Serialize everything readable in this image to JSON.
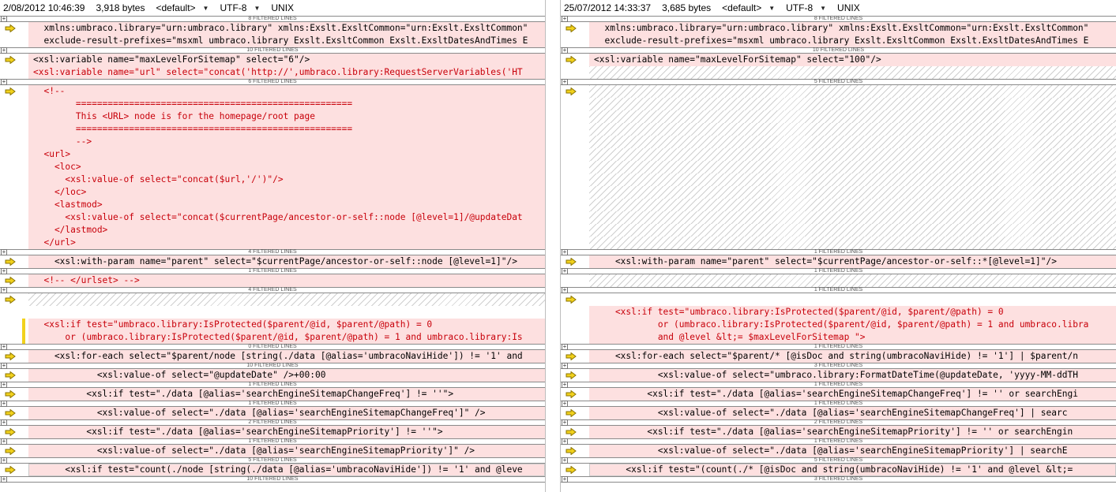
{
  "left_pane": {
    "header": {
      "timestamp": "2/08/2012 10:46:39",
      "size": "3,918 bytes",
      "profile": "<default>",
      "encoding": "UTF-8",
      "line_ending": "UNIX"
    },
    "blocks": [
      {
        "sep": "8 FILTERED LINES",
        "rows": [
          {
            "text": "  xmlns:umbraco.library=\"urn:umbraco.library\" xmlns:Exslt.ExsltCommon=\"urn:Exslt.ExsltCommon\"",
            "arrow": true,
            "style": "plain"
          },
          {
            "text": "  exclude-result-prefixes=\"msxml umbraco.library Exslt.ExsltCommon Exslt.ExsltDatesAndTimes E",
            "arrow": false,
            "style": "plain"
          }
        ]
      },
      {
        "sep": "10 FILTERED LINES",
        "rows": [
          {
            "text": "<xsl:variable name=\"maxLevelForSitemap\" select=\"6\"/>",
            "arrow": true,
            "style": "plain"
          },
          {
            "text": "<xsl:variable name=\"url\" select=\"concat('http://',umbraco.library:RequestServerVariables('HT",
            "arrow": false,
            "style": "del"
          }
        ]
      },
      {
        "sep": "6 FILTERED LINES",
        "rows": [
          {
            "text": "  <!--",
            "arrow": true,
            "style": "del"
          },
          {
            "text": "        ====================================================",
            "arrow": false,
            "style": "del"
          },
          {
            "text": "        This <URL> node is for the homepage/root page",
            "arrow": false,
            "style": "del"
          },
          {
            "text": "        ====================================================",
            "arrow": false,
            "style": "del"
          },
          {
            "text": "        -->",
            "arrow": false,
            "style": "del"
          },
          {
            "text": "  <url>",
            "arrow": false,
            "style": "del"
          },
          {
            "text": "    <loc>",
            "arrow": false,
            "style": "del"
          },
          {
            "text": "      <xsl:value-of select=\"concat($url,'/')\"/>",
            "arrow": false,
            "style": "del"
          },
          {
            "text": "    </loc>",
            "arrow": false,
            "style": "del"
          },
          {
            "text": "    <lastmod>",
            "arrow": false,
            "style": "del"
          },
          {
            "text": "      <xsl:value-of select=\"concat($currentPage/ancestor-or-self::node [@level=1]/@updateDat",
            "arrow": false,
            "style": "del"
          },
          {
            "text": "    </lastmod>",
            "arrow": false,
            "style": "del"
          },
          {
            "text": "  </url>",
            "arrow": false,
            "style": "del"
          }
        ]
      },
      {
        "sep": "4 FILTERED LINES",
        "rows": [
          {
            "text": "    <xsl:with-param name=\"parent\" select=\"$currentPage/ancestor-or-self::node [@level=1]\"/>",
            "arrow": true,
            "style": "plain"
          }
        ]
      },
      {
        "sep": "1 FILTERED LINES",
        "rows": [
          {
            "text": "  <!-- </urlset> -->",
            "arrow": true,
            "style": "del"
          }
        ]
      },
      {
        "sep": "4 FILTERED LINES",
        "rows": [
          {
            "text": "",
            "arrow": true,
            "style": "hatch"
          },
          {
            "text": "",
            "arrow": false,
            "style": "white"
          },
          {
            "text": "  <xsl:if test=\"umbraco.library:IsProtected($parent/@id, $parent/@path) = 0",
            "arrow": false,
            "style": "del",
            "bar": true
          },
          {
            "text": "      or (umbraco.library:IsProtected($parent/@id, $parent/@path) = 1 and umbraco.library:Is",
            "arrow": false,
            "style": "del",
            "bar": true
          }
        ]
      },
      {
        "sep": "0 FILTERED LINES",
        "rows": [
          {
            "text": "    <xsl:for-each select=\"$parent/node [string(./data [@alias='umbracoNaviHide']) != '1' and",
            "arrow": true,
            "style": "plain"
          }
        ]
      },
      {
        "sep": "10 FILTERED LINES",
        "rows": [
          {
            "text": "            <xsl:value-of select=\"@updateDate\" />+00:00",
            "arrow": true,
            "style": "plain"
          }
        ]
      },
      {
        "sep": "1 FILTERED LINES",
        "rows": [
          {
            "text": "          <xsl:if test=\"./data [@alias='searchEngineSitemapChangeFreq'] != ''\">",
            "arrow": true,
            "style": "plain"
          }
        ]
      },
      {
        "sep": "1 FILTERED LINES",
        "rows": [
          {
            "text": "            <xsl:value-of select=\"./data [@alias='searchEngineSitemapChangeFreq']\" />",
            "arrow": true,
            "style": "plain"
          }
        ]
      },
      {
        "sep": "2 FILTERED LINES",
        "rows": [
          {
            "text": "          <xsl:if test=\"./data [@alias='searchEngineSitemapPriority'] != ''\">",
            "arrow": true,
            "style": "plain"
          }
        ]
      },
      {
        "sep": "1 FILTERED LINES",
        "rows": [
          {
            "text": "            <xsl:value-of select=\"./data [@alias='searchEngineSitemapPriority']\" />",
            "arrow": true,
            "style": "plain"
          }
        ]
      },
      {
        "sep": "5 FILTERED LINES",
        "rows": [
          {
            "text": "      <xsl:if test=\"count(./node [string(./data [@alias='umbracoNaviHide']) != '1' and @leve",
            "arrow": true,
            "style": "boxed"
          }
        ]
      },
      {
        "sep": "10 FILTERED LINES",
        "rows": []
      }
    ]
  },
  "right_pane": {
    "header": {
      "timestamp": "25/07/2012 14:33:37",
      "size": "3,685 bytes",
      "profile": "<default>",
      "encoding": "UTF-8",
      "line_ending": "UNIX"
    },
    "blocks": [
      {
        "sep": "8 FILTERED LINES",
        "rows": [
          {
            "text": "  xmlns:umbraco.library=\"urn:umbraco.library\" xmlns:Exslt.ExsltCommon=\"urn:Exslt.ExsltCommon\"",
            "arrow": true,
            "style": "plain"
          },
          {
            "text": "  exclude-result-prefixes=\"msxml umbraco.library Exslt.ExsltCommon Exslt.ExsltDatesAndTimes E",
            "arrow": false,
            "style": "plain"
          }
        ]
      },
      {
        "sep": "10 FILTERED LINES",
        "rows": [
          {
            "text": "<xsl:variable name=\"maxLevelForSitemap\" select=\"100\"/>",
            "arrow": true,
            "style": "plain"
          },
          {
            "text": "",
            "arrow": false,
            "style": "hatch"
          }
        ]
      },
      {
        "sep": "5 FILTERED LINES",
        "rows": [
          {
            "text": "",
            "arrow": true,
            "style": "hatch"
          },
          {
            "text": "",
            "arrow": false,
            "style": "hatch"
          },
          {
            "text": "",
            "arrow": false,
            "style": "hatch"
          },
          {
            "text": "",
            "arrow": false,
            "style": "hatch"
          },
          {
            "text": "",
            "arrow": false,
            "style": "hatch"
          },
          {
            "text": "",
            "arrow": false,
            "style": "hatch"
          },
          {
            "text": "",
            "arrow": false,
            "style": "hatch"
          },
          {
            "text": "",
            "arrow": false,
            "style": "hatch"
          },
          {
            "text": "",
            "arrow": false,
            "style": "hatch"
          },
          {
            "text": "",
            "arrow": false,
            "style": "hatch"
          },
          {
            "text": "",
            "arrow": false,
            "style": "hatch"
          },
          {
            "text": "",
            "arrow": false,
            "style": "hatch"
          },
          {
            "text": "",
            "arrow": false,
            "style": "hatch"
          }
        ]
      },
      {
        "sep": "1 FILTERED LINES",
        "rows": [
          {
            "text": "    <xsl:with-param name=\"parent\" select=\"$currentPage/ancestor-or-self::*[@level=1]\"/>",
            "arrow": true,
            "style": "plain"
          }
        ]
      },
      {
        "sep": "1 FILTERED LINES",
        "rows": [
          {
            "text": "",
            "arrow": false,
            "style": "hatch"
          }
        ]
      },
      {
        "sep": "1 FILTERED LINES",
        "rows": [
          {
            "text": "",
            "arrow": true,
            "style": "white"
          },
          {
            "text": "    <xsl:if test=\"umbraco.library:IsProtected($parent/@id, $parent/@path) = 0",
            "arrow": false,
            "style": "del"
          },
          {
            "text": "            or (umbraco.library:IsProtected($parent/@id, $parent/@path) = 1 and umbraco.libra",
            "arrow": false,
            "style": "del"
          },
          {
            "text": "            and @level &lt;= $maxLevelForSitemap \">",
            "arrow": false,
            "style": "del"
          }
        ]
      },
      {
        "sep": "1 FILTERED LINES",
        "rows": [
          {
            "text": "    <xsl:for-each select=\"$parent/* [@isDoc and string(umbracoNaviHide) != '1'] | $parent/n",
            "arrow": true,
            "style": "plain"
          }
        ]
      },
      {
        "sep": "3 FILTERED LINES",
        "rows": [
          {
            "text": "            <xsl:value-of select=\"umbraco.library:FormatDateTime(@updateDate, 'yyyy-MM-ddTH",
            "arrow": true,
            "style": "plain"
          }
        ]
      },
      {
        "sep": "1 FILTERED LINES",
        "rows": [
          {
            "text": "          <xsl:if test=\"./data [@alias='searchEngineSitemapChangeFreq'] != '' or searchEngi",
            "arrow": true,
            "style": "plain"
          }
        ]
      },
      {
        "sep": "1 FILTERED LINES",
        "rows": [
          {
            "text": "            <xsl:value-of select=\"./data [@alias='searchEngineSitemapChangeFreq'] | searc",
            "arrow": true,
            "style": "plain"
          }
        ]
      },
      {
        "sep": "2 FILTERED LINES",
        "rows": [
          {
            "text": "          <xsl:if test=\"./data [@alias='searchEngineSitemapPriority'] != '' or searchEngin",
            "arrow": true,
            "style": "plain"
          }
        ]
      },
      {
        "sep": "1 FILTERED LINES",
        "rows": [
          {
            "text": "            <xsl:value-of select=\"./data [@alias='searchEngineSitemapPriority'] | searchE",
            "arrow": true,
            "style": "plain"
          }
        ]
      },
      {
        "sep": "5 FILTERED LINES",
        "rows": [
          {
            "text": "      <xsl:if test=\"(count(./* [@isDoc and string(umbracoNaviHide) != '1' and @level &lt;=",
            "arrow": true,
            "style": "boxed"
          }
        ]
      },
      {
        "sep": "3 FILTERED LINES",
        "rows": []
      }
    ]
  },
  "colors": {
    "diff_bg": "#fde0e0",
    "diff_text": "#c8000a",
    "arrow_fill": "#f2d21c",
    "arrow_stroke": "#8a7300",
    "change_bar": "#f2d21c"
  }
}
